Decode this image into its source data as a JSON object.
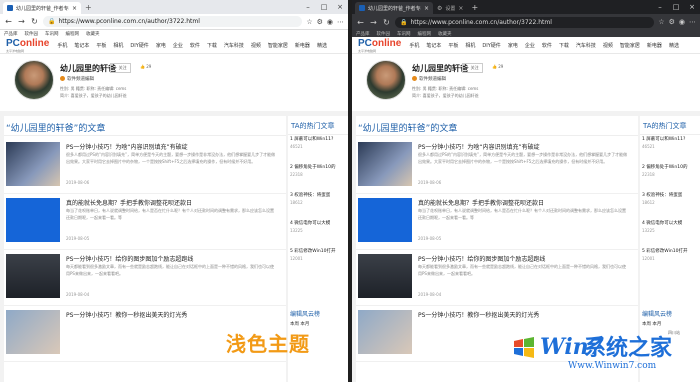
{
  "tab": {
    "title": "幼儿园里的轩爸_作者专栏_太平..."
  },
  "browser": {
    "url": "https://www.pconline.com.cn/author/3722.html",
    "fav_bar_items": [
      "产品库",
      "软件园",
      "车讯网",
      "编程网",
      "收藏夹"
    ]
  },
  "right_browser": {
    "second_tab": "设置"
  },
  "site": {
    "logo_p": "PC",
    "logo_rest": "online",
    "logo_sub": "太平洋电脑网",
    "nav": [
      "手机",
      "笔记本",
      "平板",
      "相机",
      "DIY硬件",
      "家电",
      "企业",
      "软件",
      "下载",
      "汽车科技",
      "视频",
      "智能家居",
      "新电器",
      "精选"
    ]
  },
  "profile": {
    "name": "幼儿园里的轩爸",
    "follow": "+ 关注",
    "likes": "👍 29",
    "tag": "软件频道编辑",
    "meta": "性别: 男    籍贯:          职称:          责任编辑:  cems",
    "motto": "简介: 喜爱孩子，爱孩子的幼儿园轩爸"
  },
  "section_title": "“幼儿园里的轩爸”的文章",
  "articles": [
    {
      "title": "PS一分钟小技巧！为啥“内容识别填充”有破绽",
      "excerpt": "很多人都用过PS的“内容识别填充”，简单方便是今天的主题，要想一步操作是非常没办法，他们想掌握要几步了才能做出效果。大家平时用它去掉图片中的杂物，一个是按按Shift+F5之后选择填充的操作，但有时候并不好用。",
      "date": "2019-08-06",
      "views": "☆ 评论"
    },
    {
      "title": "真的能就长免息期？手把手教你调整花呗还款日",
      "excerpt": "每当了花呗账单日，有人说就调整时间给，有人是否在忙什么呢？有个人对还款时间的调整有需求，那么应该怎么设置还款日期呢，一起来看一看。等",
      "date": "2019-08-05",
      "views": "☆ 评论"
    },
    {
      "title": "PS一分钟小技巧！给你的图步图加个励志超跑线",
      "excerpt": "每天都能看到很多激励文章，而有一些就是励志超跑线，能让自己在对话框中的上面是一种不错的风格，我们也可以使用PS来做出来，一起来看看吧。",
      "date": "2019-08-04",
      "views": "☆ 评论"
    },
    {
      "title": "PS一分钟小技巧！教你一秒抠出美天的灯光秀",
      "excerpt": "",
      "date": "",
      "views": ""
    }
  ],
  "side": {
    "title": "TA的热门文章",
    "items": [
      {
        "title": "1 屏蔽可以和Win11?",
        "num": "46521"
      },
      {
        "title": "2 偏移角处于Win10的",
        "num": "22318"
      },
      {
        "title": "3 权验神技：将蛋蛋",
        "num": "18612"
      },
      {
        "title": "4 微信电你可以大模",
        "num": "13225"
      },
      {
        "title": "5 彩信修改Win10打开",
        "num": "12001"
      }
    ],
    "editor_title": "编辑风云榜",
    "editor_tabs": "本周       本月"
  },
  "right_corner": "四川站",
  "overlay_label": "浅色主题",
  "watermark": {
    "brand": "系统之家",
    "sub": "Win7",
    "url": "Www.Winwin7.com"
  },
  "colors": {
    "accent": "#1e5fa8",
    "logo_red": "#e7432b",
    "overlay": "#f29a16",
    "dark_chrome": "#1f2023"
  }
}
